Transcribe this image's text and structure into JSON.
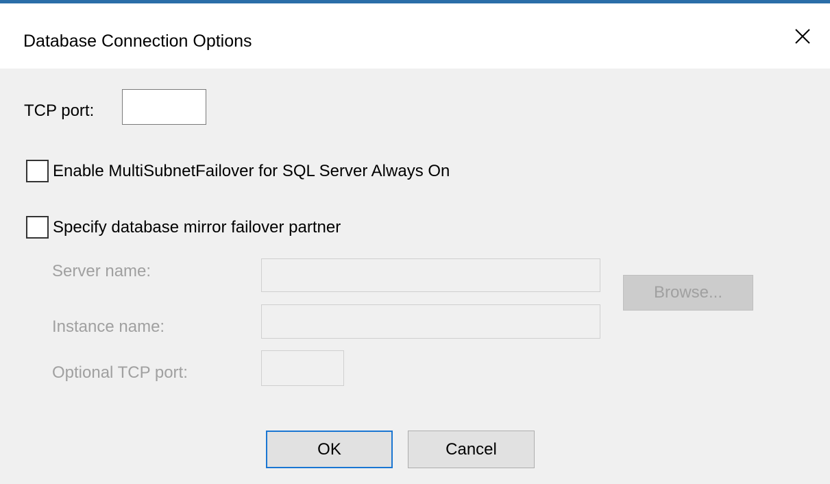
{
  "window": {
    "title": "Database Connection Options",
    "accent_color": "#2b6ea8"
  },
  "tcp_port": {
    "label": "TCP port:",
    "value": ""
  },
  "multisubnet": {
    "label": "Enable MultiSubnetFailover for SQL Server Always On",
    "checked": false
  },
  "mirror": {
    "label": "Specify database mirror failover partner",
    "checked": false,
    "server_name_label": "Server name:",
    "server_name_value": "",
    "instance_name_label": "Instance name:",
    "instance_name_value": "",
    "optional_port_label": "Optional TCP port:",
    "optional_port_value": "",
    "browse_label": "Browse..."
  },
  "buttons": {
    "ok_label": "OK",
    "cancel_label": "Cancel"
  },
  "icons": {
    "close": "close-icon"
  }
}
